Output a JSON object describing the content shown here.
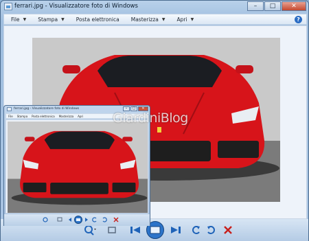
{
  "window": {
    "title": "ferrari.jpg - Visualizzatore foto di Windows",
    "minimize_glyph": "–",
    "maximize_glyph": "□",
    "close_glyph": "✕"
  },
  "menu": {
    "items": [
      {
        "label": "File"
      },
      {
        "label": "Stampa"
      },
      {
        "label": "Posta elettronica"
      },
      {
        "label": "Masterizza"
      },
      {
        "label": "Apri"
      }
    ],
    "help_glyph": "?"
  },
  "mini_window": {
    "title": "ferrari.jpg - Visualizzatore foto di Windows",
    "menu_items": [
      "File",
      "Stampa",
      "Posta elettronica",
      "Masterizza",
      "Apri"
    ]
  },
  "watermark": "GiardiniBlog",
  "controls": {
    "icons": [
      "zoom-icon",
      "fit-icon",
      "previous-icon",
      "slideshow-icon",
      "next-icon",
      "rotate-left-icon",
      "rotate-right-icon",
      "delete-icon"
    ]
  },
  "colors": {
    "car_red": "#d7141a",
    "accent_blue": "#1f63b8",
    "delete_red": "#c8201c"
  }
}
